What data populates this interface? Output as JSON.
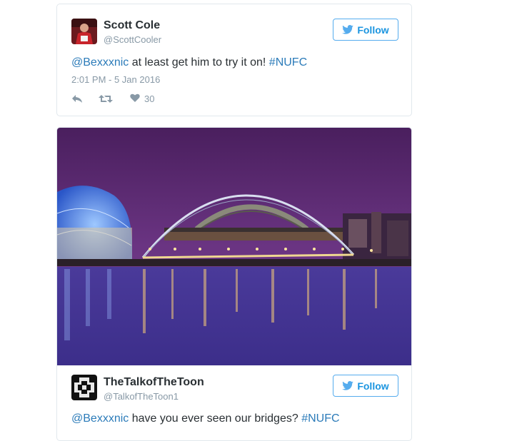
{
  "tweets": [
    {
      "name": "Scott Cole",
      "handle": "@ScottCooler",
      "follow_label": "Follow",
      "mention": "@Bexxxnic",
      "text": " at least get him to try it on! ",
      "hashtag": "#NUFC",
      "time": "2:01 PM - 5 Jan 2016",
      "likes": "30"
    },
    {
      "name": "TheTalkofTheToon",
      "handle": "@TalkofTheToon1",
      "follow_label": "Follow",
      "mention": "@Bexxxnic",
      "text": " have you ever seen our bridges? ",
      "hashtag": "#NUFC"
    }
  ],
  "icons": {
    "reply": "reply-icon",
    "retweet": "retweet-icon",
    "like": "heart-icon",
    "follow_bird": "twitter-bird-icon"
  },
  "colors": {
    "link": "#2b7bb9",
    "follow_border": "#55acee",
    "muted": "#8899a6",
    "sky": "#5a2a6e",
    "water": "#4a3aa8"
  }
}
